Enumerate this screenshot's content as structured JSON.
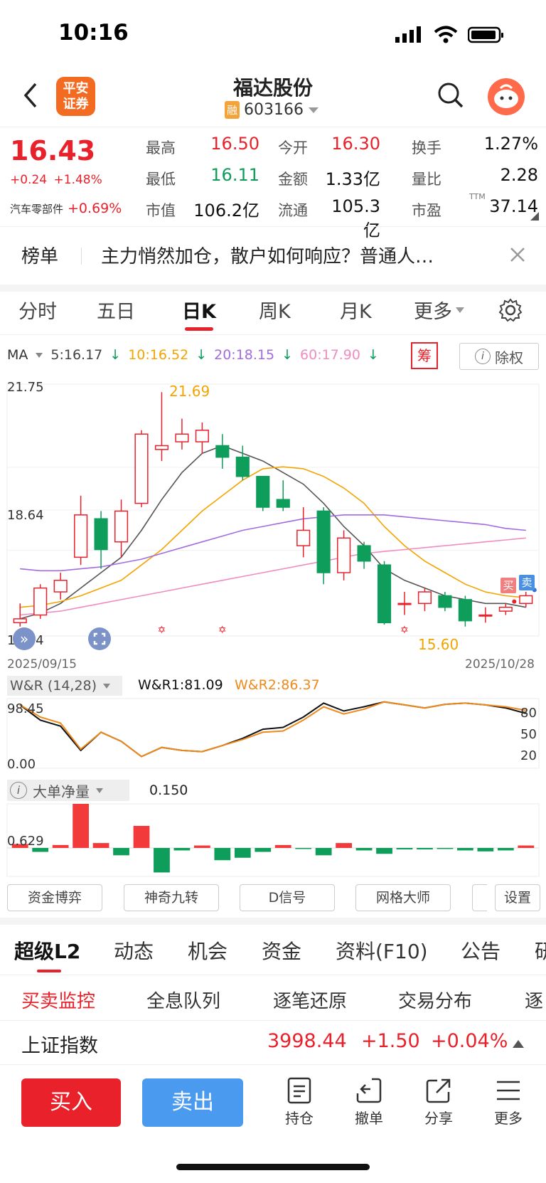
{
  "status": {
    "time": "10:16"
  },
  "nav": {
    "title": "福达股份",
    "code": "603166",
    "rong": "融",
    "logo_line1": "平安",
    "logo_line2": "证券"
  },
  "quote": {
    "price": "16.43",
    "change": "+0.24",
    "change_pct": "+1.48%",
    "sector_name": "汽车零部件",
    "sector_pct": "+0.69%",
    "fields": [
      {
        "label": "最高",
        "value": "16.50",
        "color": "#e8212b"
      },
      {
        "label": "今开",
        "value": "16.30",
        "color": "#e8212b"
      },
      {
        "label": "换手",
        "value": "1.27%",
        "color": "#111111"
      },
      {
        "label": "最低",
        "value": "16.11",
        "color": "#0e9d5a"
      },
      {
        "label": "金额",
        "value": "1.33亿",
        "color": "#111111"
      },
      {
        "label": "量比",
        "value": "2.28",
        "color": "#111111"
      },
      {
        "label": "市值",
        "value": "106.2亿",
        "color": "#111111"
      },
      {
        "label": "流通",
        "value": "105.3亿",
        "color": "#111111"
      },
      {
        "label": "市盈",
        "value": "37.14",
        "color": "#111111"
      }
    ],
    "ttm": "TTM"
  },
  "notice": {
    "tag": "榜单",
    "text": "主力悄然加仓，散户如何响应？普通人…"
  },
  "period_tabs": [
    "分时",
    "五日",
    "日K",
    "周K",
    "月K",
    "更多"
  ],
  "ma": {
    "label": "MA",
    "ma5": "5:16.17",
    "ma10": "10:16.52",
    "ma20": "20:18.15",
    "ma60": "60:17.90",
    "chou": "筹",
    "chuquan": "除权"
  },
  "chart_data": [
    {
      "type": "candlestick",
      "title": "",
      "x_start": "2025/09/15",
      "x_end": "2025/10/28",
      "ylim": [
        15.54,
        21.75
      ],
      "y_ticks": [
        "21.75",
        "18.64",
        "15.54"
      ],
      "max_label": "21.69",
      "min_label": "15.60",
      "candles": [
        {
          "o": 15.7,
          "c": 15.8,
          "h": 16.2,
          "l": 15.6
        },
        {
          "o": 15.9,
          "c": 16.6,
          "h": 16.7,
          "l": 15.8
        },
        {
          "o": 16.5,
          "c": 16.8,
          "h": 17.0,
          "l": 16.3
        },
        {
          "o": 17.4,
          "c": 18.5,
          "h": 19.0,
          "l": 17.2
        },
        {
          "o": 18.4,
          "c": 17.6,
          "h": 18.6,
          "l": 17.1
        },
        {
          "o": 17.8,
          "c": 18.6,
          "h": 18.9,
          "l": 17.4
        },
        {
          "o": 18.8,
          "c": 20.6,
          "h": 20.7,
          "l": 18.7
        },
        {
          "o": 20.2,
          "c": 20.3,
          "h": 21.69,
          "l": 19.9
        },
        {
          "o": 20.4,
          "c": 20.6,
          "h": 21.0,
          "l": 20.2
        },
        {
          "o": 20.4,
          "c": 20.7,
          "h": 20.9,
          "l": 20.1
        },
        {
          "o": 20.3,
          "c": 20.0,
          "h": 20.6,
          "l": 19.7
        },
        {
          "o": 20.0,
          "c": 19.5,
          "h": 20.3,
          "l": 19.4
        },
        {
          "o": 19.5,
          "c": 18.7,
          "h": 19.5,
          "l": 18.6
        },
        {
          "o": 18.9,
          "c": 18.7,
          "h": 19.4,
          "l": 18.6
        },
        {
          "o": 17.7,
          "c": 18.1,
          "h": 18.7,
          "l": 17.4
        },
        {
          "o": 18.6,
          "c": 17.0,
          "h": 18.7,
          "l": 16.7
        },
        {
          "o": 17.0,
          "c": 17.9,
          "h": 18.1,
          "l": 16.8
        },
        {
          "o": 17.7,
          "c": 17.3,
          "h": 17.8,
          "l": 17.1
        },
        {
          "o": 17.2,
          "c": 15.7,
          "h": 17.3,
          "l": 15.65
        },
        {
          "o": 16.2,
          "c": 16.2,
          "h": 16.5,
          "l": 15.9
        },
        {
          "o": 16.2,
          "c": 16.5,
          "h": 16.6,
          "l": 16.0
        },
        {
          "o": 16.4,
          "c": 16.1,
          "h": 16.5,
          "l": 16.0
        },
        {
          "o": 16.3,
          "c": 15.75,
          "h": 16.4,
          "l": 15.6
        },
        {
          "o": 15.9,
          "c": 15.9,
          "h": 16.1,
          "l": 15.7
        },
        {
          "o": 16.0,
          "c": 16.1,
          "h": 16.2,
          "l": 15.9
        },
        {
          "o": 16.2,
          "c": 16.4,
          "h": 16.5,
          "l": 16.1
        }
      ],
      "ma_lines": [
        {
          "name": "MA5",
          "color": "#555555",
          "values": [
            15.8,
            15.95,
            16.2,
            16.6,
            17.0,
            17.4,
            18.1,
            18.9,
            19.6,
            20.1,
            20.3,
            20.1,
            19.9,
            19.6,
            19.3,
            18.8,
            18.2,
            17.7,
            17.1,
            16.8,
            16.6,
            16.4,
            16.3,
            16.2,
            16.2,
            16.1
          ]
        },
        {
          "name": "MA10",
          "color": "#f4a400",
          "values": [
            16.1,
            16.15,
            16.25,
            16.4,
            16.6,
            16.8,
            17.2,
            17.6,
            18.1,
            18.6,
            19.0,
            19.4,
            19.7,
            19.75,
            19.7,
            19.5,
            19.2,
            18.8,
            18.2,
            17.7,
            17.3,
            17.0,
            16.7,
            16.5,
            16.4,
            16.35
          ]
        },
        {
          "name": "MA20",
          "color": "#a36be0",
          "values": [
            17.1,
            17.05,
            17.05,
            17.1,
            17.15,
            17.25,
            17.35,
            17.5,
            17.65,
            17.8,
            17.95,
            18.1,
            18.2,
            18.3,
            18.4,
            18.45,
            18.5,
            18.5,
            18.5,
            18.45,
            18.4,
            18.35,
            18.3,
            18.25,
            18.15,
            18.1
          ]
        },
        {
          "name": "MA60",
          "color": "#f08cc0",
          "values": [
            15.9,
            15.95,
            16.0,
            16.1,
            16.2,
            16.3,
            16.4,
            16.5,
            16.6,
            16.7,
            16.8,
            16.9,
            17.0,
            17.1,
            17.2,
            17.3,
            17.4,
            17.5,
            17.55,
            17.6,
            17.65,
            17.7,
            17.75,
            17.8,
            17.85,
            17.9
          ]
        }
      ]
    },
    {
      "type": "line",
      "title": "W&R (14,28)",
      "legend": [
        {
          "name": "W&R1:81.09",
          "color": "#111111"
        },
        {
          "name": "W&R2:86.37",
          "color": "#ee8a1c"
        }
      ],
      "ylim": [
        0,
        98.45
      ],
      "y_ticks_left": [
        "98.45",
        "0.00"
      ],
      "y_ticks_right": [
        "80",
        "50",
        "20"
      ],
      "series": [
        {
          "name": "W&R1",
          "color": "#111111",
          "values": [
            95,
            70,
            60,
            20,
            50,
            35,
            10,
            25,
            20,
            18,
            28,
            40,
            55,
            58,
            75,
            98,
            85,
            92,
            100,
            95,
            90,
            96,
            98,
            95,
            90,
            81
          ]
        },
        {
          "name": "W&R2",
          "color": "#ee8a1c",
          "values": [
            95,
            75,
            65,
            22,
            50,
            35,
            10,
            25,
            20,
            18,
            28,
            38,
            50,
            52,
            70,
            92,
            80,
            88,
            100,
            95,
            90,
            96,
            98,
            95,
            92,
            86
          ]
        }
      ]
    },
    {
      "type": "bar",
      "title": "大单净量",
      "value_label": "0.150",
      "y_tick": "0.629",
      "values": [
        0.08,
        -0.08,
        0.06,
        0.9,
        0.1,
        -0.15,
        0.45,
        -0.5,
        -0.05,
        0.05,
        -0.25,
        -0.2,
        -0.08,
        0.06,
        -0.02,
        -0.15,
        0.1,
        -0.05,
        -0.12,
        -0.03,
        -0.03,
        -0.02,
        -0.05,
        -0.07,
        -0.05,
        0.05
      ]
    }
  ],
  "chips": [
    "资金博弈",
    "神奇九转",
    "D信号",
    "网格大师",
    "设置"
  ],
  "big_tabs": [
    "超级L2",
    "动态",
    "机会",
    "资金",
    "资料(F10)",
    "公告",
    "研"
  ],
  "sub_tabs": [
    "买卖监控",
    "全息队列",
    "逐笔还原",
    "交易分布",
    "逐"
  ],
  "index": {
    "name": "上证指数",
    "value": "3998.44",
    "change": "+1.50",
    "pct": "+0.04%"
  },
  "actions": {
    "buy": "买入",
    "sell": "卖出"
  },
  "tools": [
    "持仓",
    "撤单",
    "分享",
    "更多"
  ],
  "markers": {
    "buy": "买",
    "sell": "卖"
  }
}
